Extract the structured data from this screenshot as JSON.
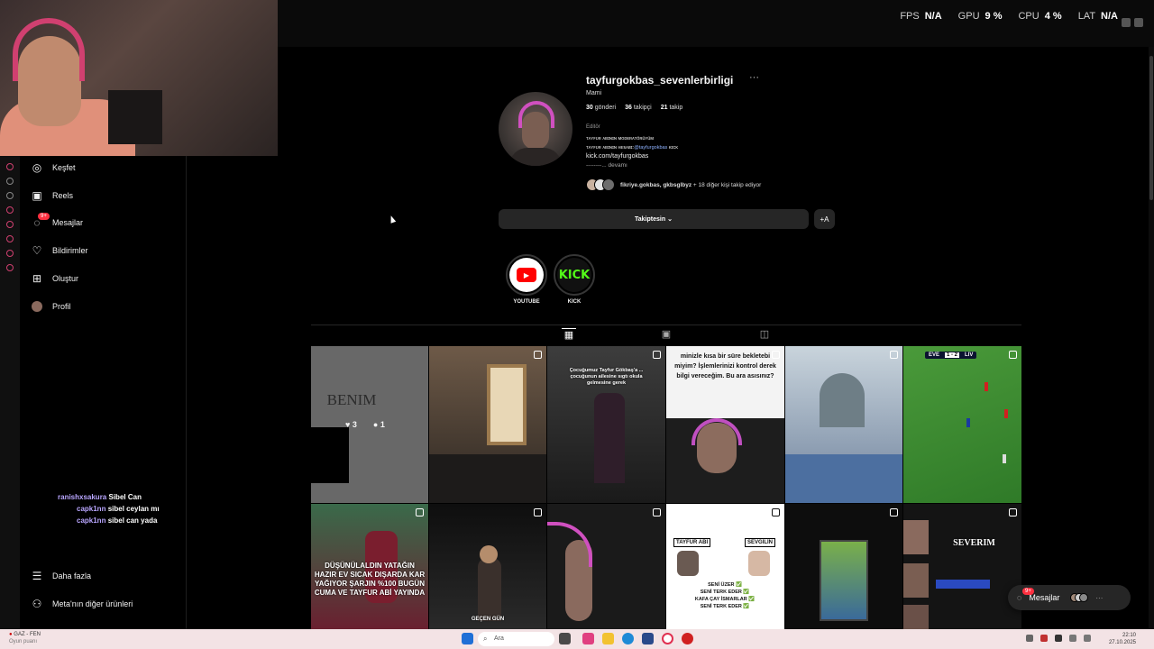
{
  "overlay": {
    "fps_label": "FPS",
    "fps_value": "N/A",
    "gpu_label": "GPU",
    "gpu_value": "9 %",
    "cpu_label": "CPU",
    "cpu_value": "4 %",
    "lat_label": "LAT",
    "lat_value": "N/A"
  },
  "sidebar": {
    "items": [
      {
        "label": "Keşfet",
        "icon": "compass-icon"
      },
      {
        "label": "Reels",
        "icon": "reels-icon"
      },
      {
        "label": "Mesajlar",
        "icon": "messenger-icon",
        "badge": "9+"
      },
      {
        "label": "Bildirimler",
        "icon": "heart-icon"
      },
      {
        "label": "Oluştur",
        "icon": "plus-square-icon"
      },
      {
        "label": "Profil",
        "icon": "avatar"
      }
    ],
    "more_label": "Daha fazla",
    "meta_label": "Meta'nın diğer ürünleri"
  },
  "chat": [
    {
      "user": "ranishxsakura",
      "message": "Sibel Can"
    },
    {
      "user": "capk1nn",
      "message": "sibel ceylan mı"
    },
    {
      "user": "capk1nn",
      "message": "sibel can yada"
    }
  ],
  "profile": {
    "username": "tayfurgokbas_sevenlerbirligi",
    "more": "···",
    "full_name": "Mami",
    "posts_count": "30",
    "posts_label": "gönderi",
    "followers_count": "36",
    "followers_label": "takipçi",
    "following_count": "21",
    "following_label": "takip",
    "category": "Editör",
    "bio_line1": "ᴛᴀʏꜰᴜʀ ᴀʙɪɴɪɴ ᴍᴏᴅᴇʀᴀᴛöʀüʏüᴍ",
    "bio_line2_prefix": "ᴛᴀʏꜰᴜʀ ᴀʙɪɴɪɴ ʜᴇꜱᴀʙɪ:",
    "bio_line2_link": "@tayfurgokbas",
    "bio_line2_suffix": " ᴋɪᴄᴋ",
    "bio_line3": "kick.com/tayfurgokbas",
    "bio_line4": "--------... devamı",
    "followed_by_names": "fikriye.gokbas, gkbsglbyz",
    "followed_by_rest": " + 18 diğer kişi takip ediyor",
    "follow_button": "Takiptesin ⌄",
    "add_button": "+A"
  },
  "highlights": [
    {
      "label": "YOUTUBE"
    },
    {
      "label": "KICK",
      "logo_text": "KICK"
    }
  ],
  "posts": {
    "tile1_text": "BENIM",
    "tile1_likes": "3",
    "tile1_comments": "1",
    "tile3_caption": "Çocuğumuz Tayfur Gökbaş'a ... çocuğunun ailesine sıgtı okula gelmesine gerek",
    "tile4_caption": "minizle kısa bir süre bekletebi miyim? İşlemlerinizi kontrol derek bilgi vereceğim. Bu ara asısınız?",
    "tile6_score_left": "EVE",
    "tile6_score": "1 - 2",
    "tile6_score_right": "LIV",
    "tile7_caption": "DÜŞÜNÜLALDIN YATAĞIN HAZIR EV SICAK DIŞARDA KAR YAĞIYOR ŞARJIN %100 BUGÜN CUMA VE TAYFUR ABİ YAYINDA",
    "tile8_caption": "GEÇEN GÜN",
    "tile10_left": "TAYFUR ABİ",
    "tile10_right": "SEVGİLİN",
    "tile10_lines": [
      "SENİ ÜZER ✅",
      "SENİ TERK EDER ✅",
      "KAFA ÇAY İSMARLAR ✅",
      "SENİ TERK EDER ✅"
    ],
    "tile12_text": "SEVERIM"
  },
  "messages_pill": {
    "label": "Mesajlar",
    "badge": "9+"
  },
  "taskbar": {
    "weather_title": "GAZ - FEN",
    "weather_sub": "Oyun puanı",
    "search_placeholder": "Ara",
    "time": "22:10",
    "date": "27.10.2025"
  },
  "colors": {
    "accent_pink": "#d04070",
    "link_blue": "#8fb3ff",
    "badge_red": "#ff3040"
  }
}
